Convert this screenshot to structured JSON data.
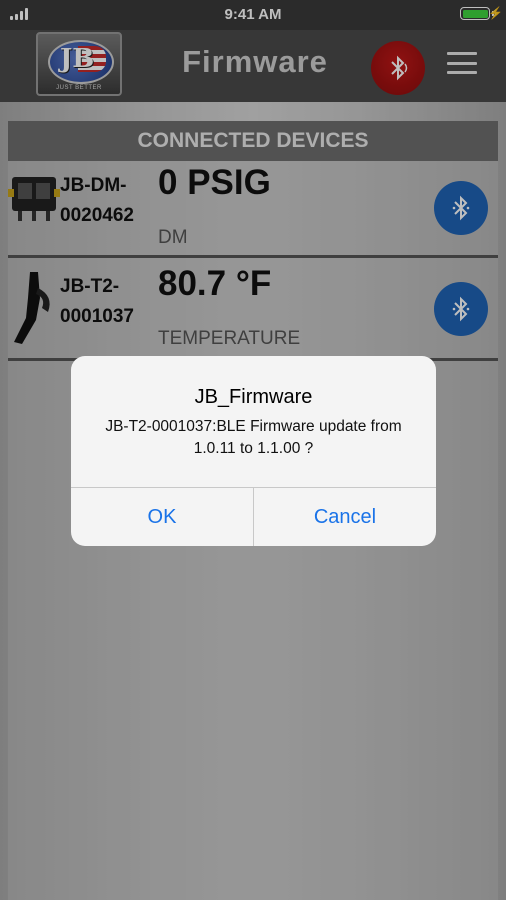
{
  "status_bar": {
    "time": "9:41 AM"
  },
  "nav": {
    "title": "Firmware",
    "logo_text": "JB",
    "logo_tagline": "JUST BETTER"
  },
  "devices": {
    "header": "CONNECTED DEVICES",
    "items": [
      {
        "id_line1": "JB-DM-",
        "id_line2": "0020462",
        "reading": "0 PSIG",
        "label": "DM",
        "icon": "digital-manifold-icon"
      },
      {
        "id_line1": "JB-T2-",
        "id_line2": "0001037",
        "reading": "80.7 °F",
        "label": "TEMPERATURE",
        "icon": "temperature-clamp-icon"
      }
    ]
  },
  "alert": {
    "title": "JB_Firmware",
    "message": "JB-T2-0001037:BLE Firmware update from 1.0.11 to 1.1.00 ?",
    "ok_label": "OK",
    "cancel_label": "Cancel"
  },
  "colors": {
    "alert_button": "#1a73e8",
    "bt_active": "#1f63b5",
    "bt_header": "#b01414"
  }
}
